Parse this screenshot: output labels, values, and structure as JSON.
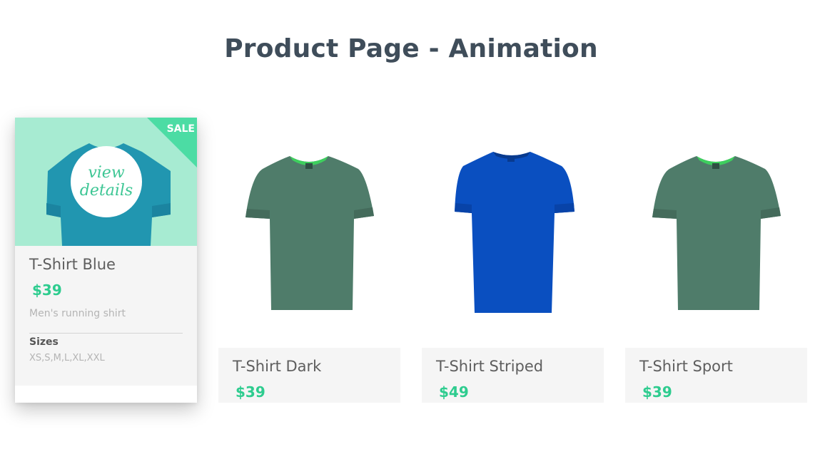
{
  "page": {
    "title": "Product Page - Animation"
  },
  "products": [
    {
      "name": "T-Shirt Blue",
      "price": "$39",
      "description": "Men's running shirt",
      "sizes_label": "Sizes",
      "sizes": "XS,S,M,L,XL,XXL",
      "sale_label": "SALE",
      "hover_action": [
        "view",
        "details"
      ],
      "color": "#2196b0"
    },
    {
      "name": "T-Shirt Dark",
      "price": "$39",
      "color": "#4f7c6a"
    },
    {
      "name": "T-Shirt Striped",
      "price": "$49",
      "color": "#0a4fc0"
    },
    {
      "name": "T-Shirt Sport",
      "price": "$39",
      "color": "#4f7c6a"
    }
  ],
  "colors": {
    "price": "#2ecc8f",
    "sale_ribbon": "#4cdca4",
    "featured_bg": "#a7ebd2",
    "title": "#3f4d5a",
    "collar_accent": "#3ecf5e"
  }
}
